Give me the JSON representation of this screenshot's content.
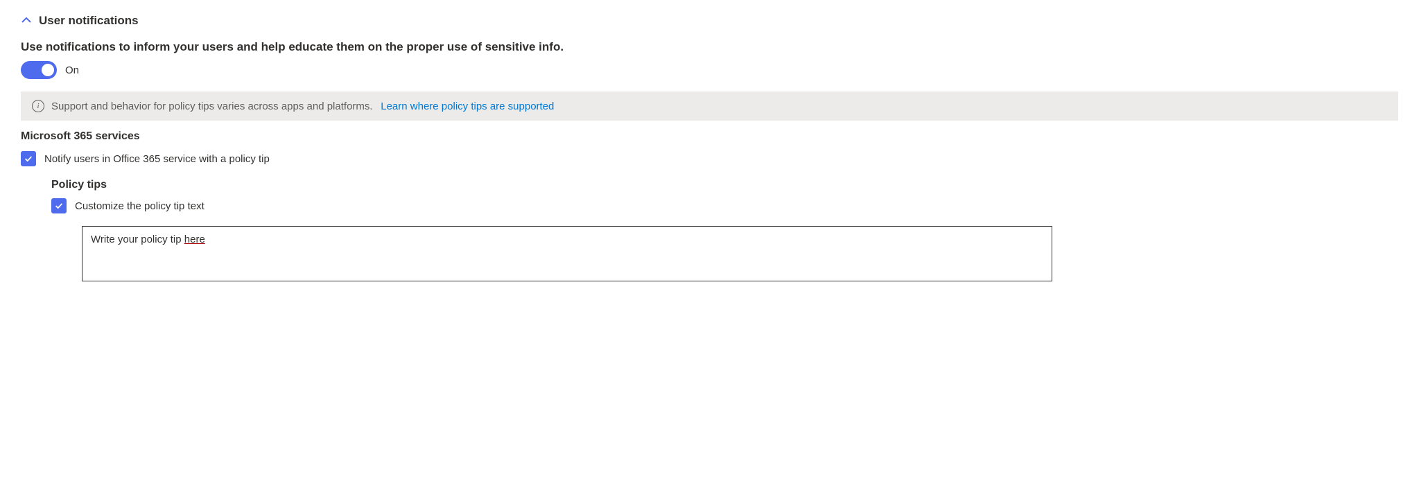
{
  "section": {
    "title": "User notifications",
    "description": "Use notifications to inform your users and help educate them on the proper use of sensitive info.",
    "toggle_label": "On"
  },
  "info": {
    "text": "Support and behavior for policy tips varies across apps and platforms.",
    "link": "Learn where policy tips are supported"
  },
  "m365": {
    "title": "Microsoft 365 services",
    "notify_label": "Notify users in Office 365 service with a policy tip"
  },
  "policy_tips": {
    "title": "Policy tips",
    "customize_label": "Customize the policy tip text",
    "textarea_prefix": "Write your policy tip ",
    "textarea_underlined": "here"
  }
}
